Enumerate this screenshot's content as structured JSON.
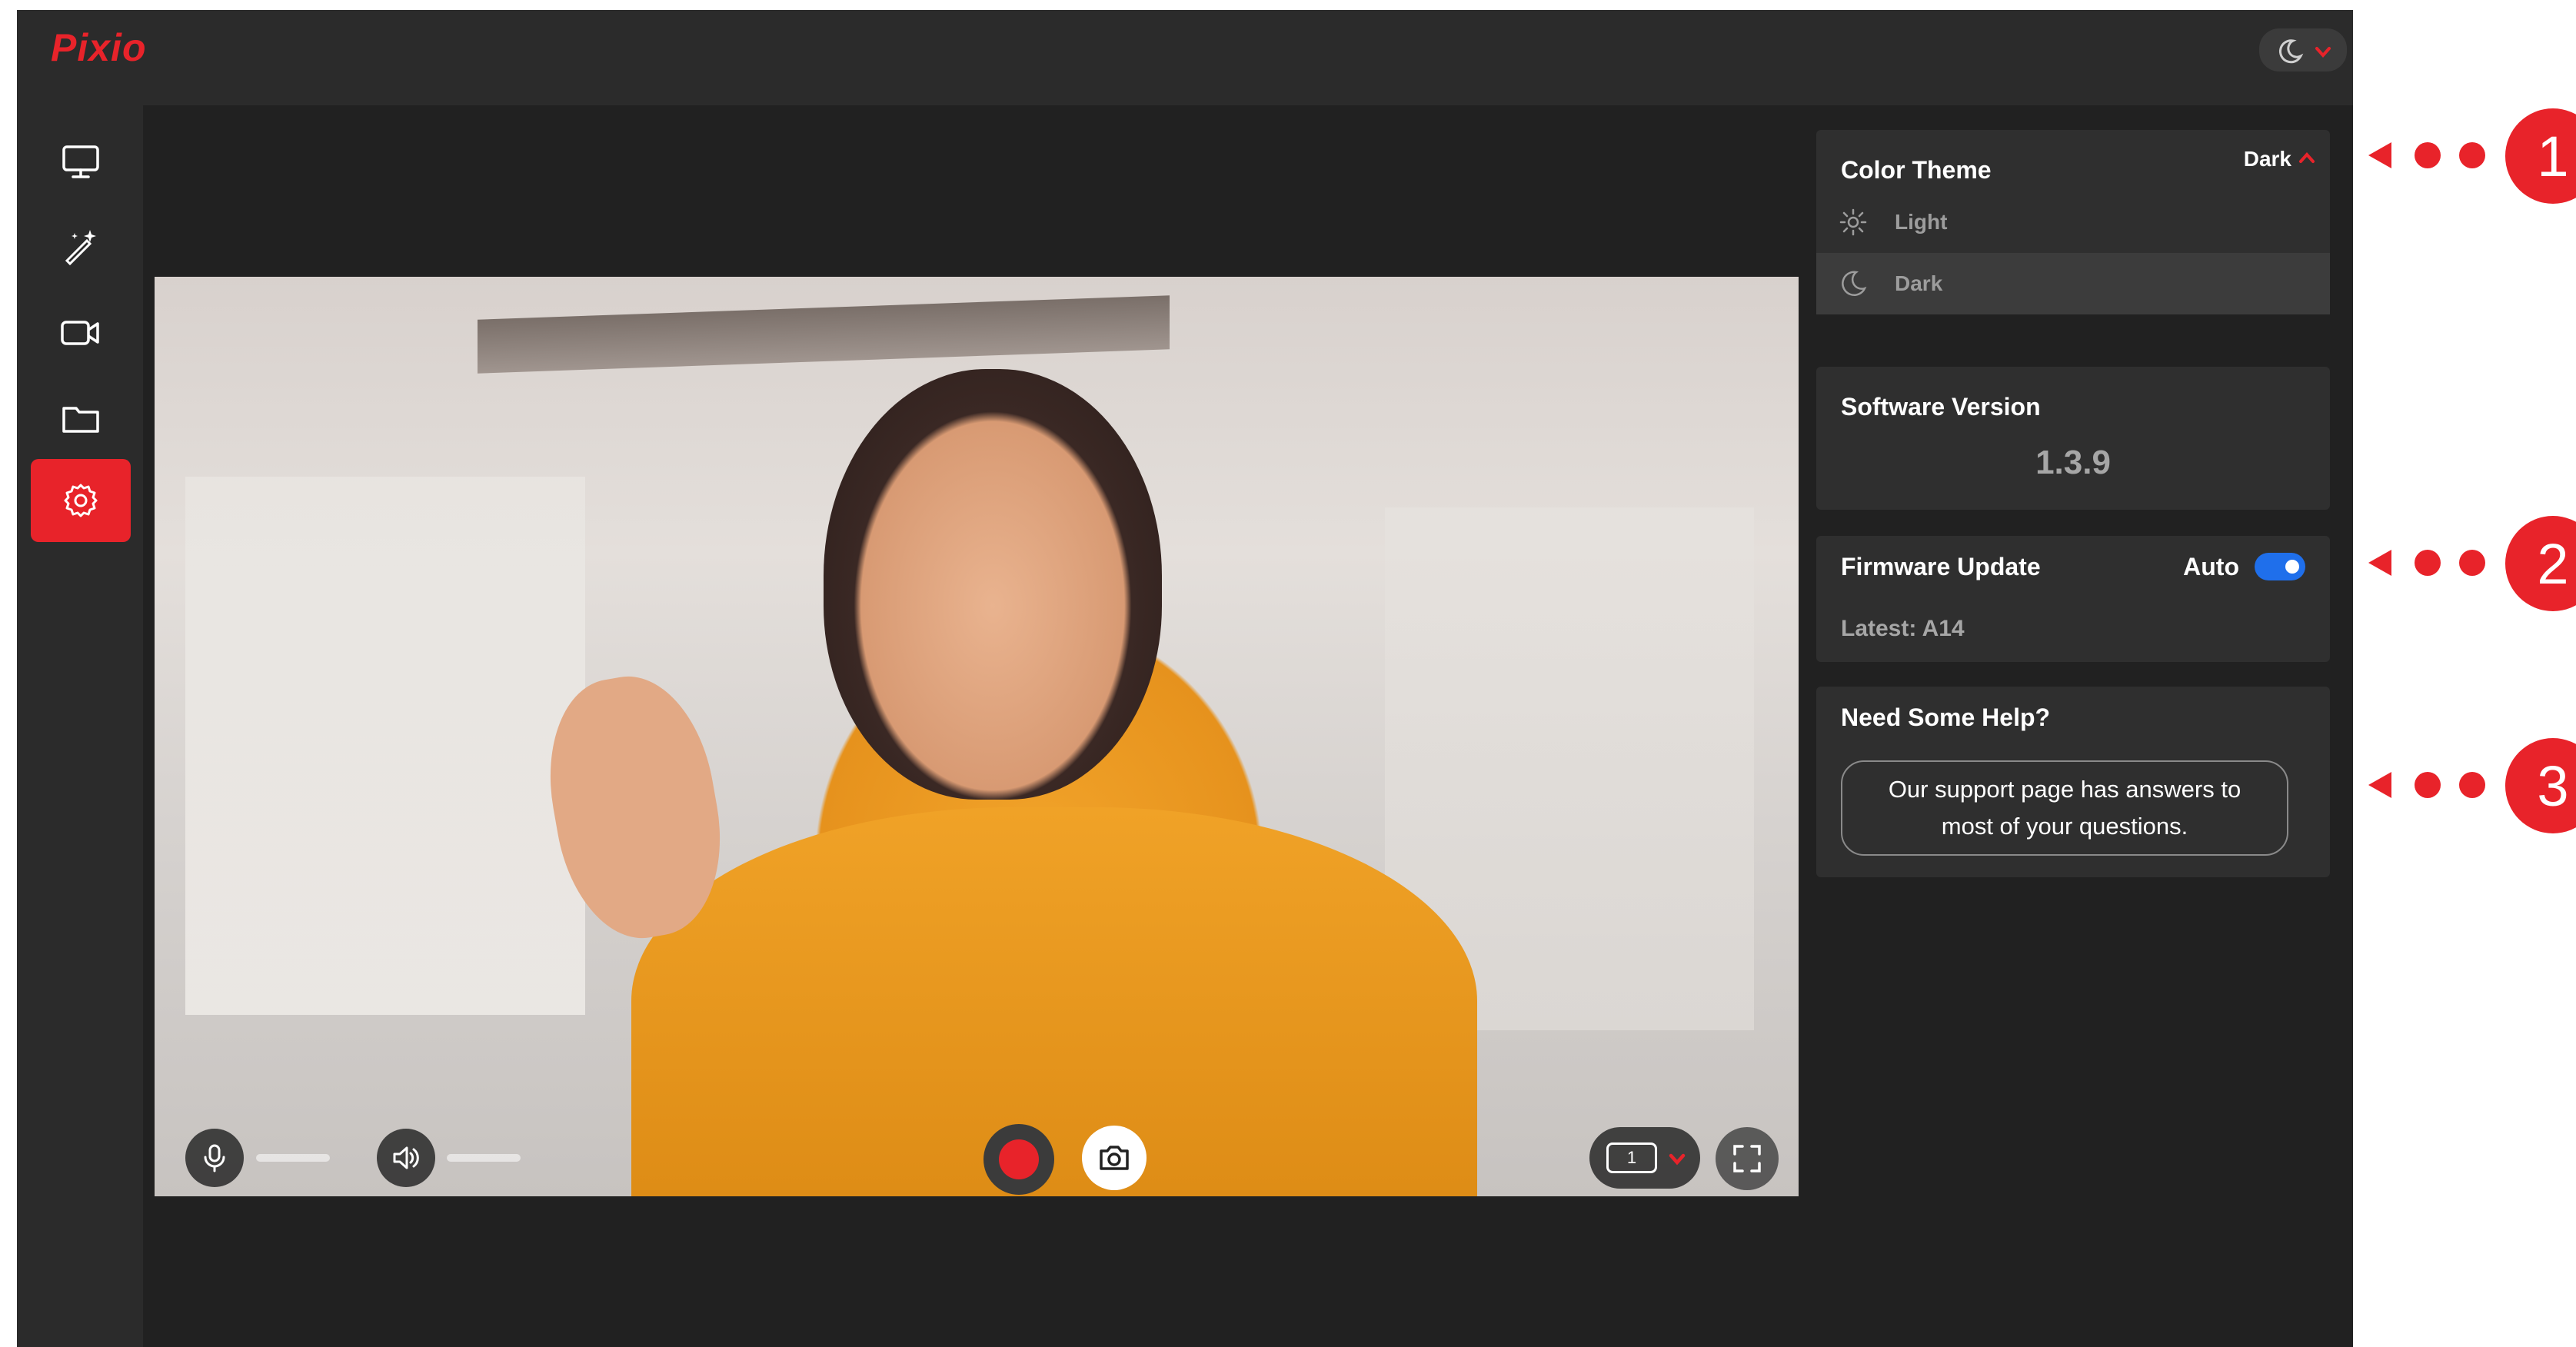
{
  "app": {
    "logo": "Pixio"
  },
  "header": {
    "theme_toggle_icon": "moon-icon",
    "theme_toggle_chevron": "chevron-down-icon"
  },
  "sidebar": {
    "items": [
      {
        "name": "monitor",
        "icon": "monitor-icon",
        "active": false
      },
      {
        "name": "effects",
        "icon": "magic-wand-icon",
        "active": false
      },
      {
        "name": "camera",
        "icon": "video-camera-icon",
        "active": false
      },
      {
        "name": "folder",
        "icon": "folder-icon",
        "active": false
      },
      {
        "name": "settings",
        "icon": "gear-icon",
        "active": true
      }
    ]
  },
  "video_controls": {
    "microphone_icon": "microphone-icon",
    "speaker_icon": "speaker-icon",
    "record_icon": "record-icon",
    "snapshot_icon": "camera-icon",
    "layout_number": "1",
    "fullscreen_icon": "fullscreen-icon"
  },
  "settings": {
    "color_theme": {
      "title": "Color Theme",
      "current": "Dark",
      "options": [
        {
          "label": "Light",
          "icon": "sun-icon"
        },
        {
          "label": "Dark",
          "icon": "moon-icon"
        }
      ]
    },
    "software_version": {
      "title": "Software Version",
      "value": "1.3.9"
    },
    "firmware_update": {
      "title": "Firmware Update",
      "auto_label": "Auto",
      "auto_enabled": true,
      "latest": "Latest: A14"
    },
    "help": {
      "title": "Need Some Help?",
      "link_text": "Our support page has answers to most of your questions."
    }
  },
  "callouts": [
    "1",
    "2",
    "3"
  ],
  "colors": {
    "accent": "#e8232a",
    "toggle_on": "#1f6feb",
    "background": "#212121",
    "panel": "#2f2f2f"
  }
}
